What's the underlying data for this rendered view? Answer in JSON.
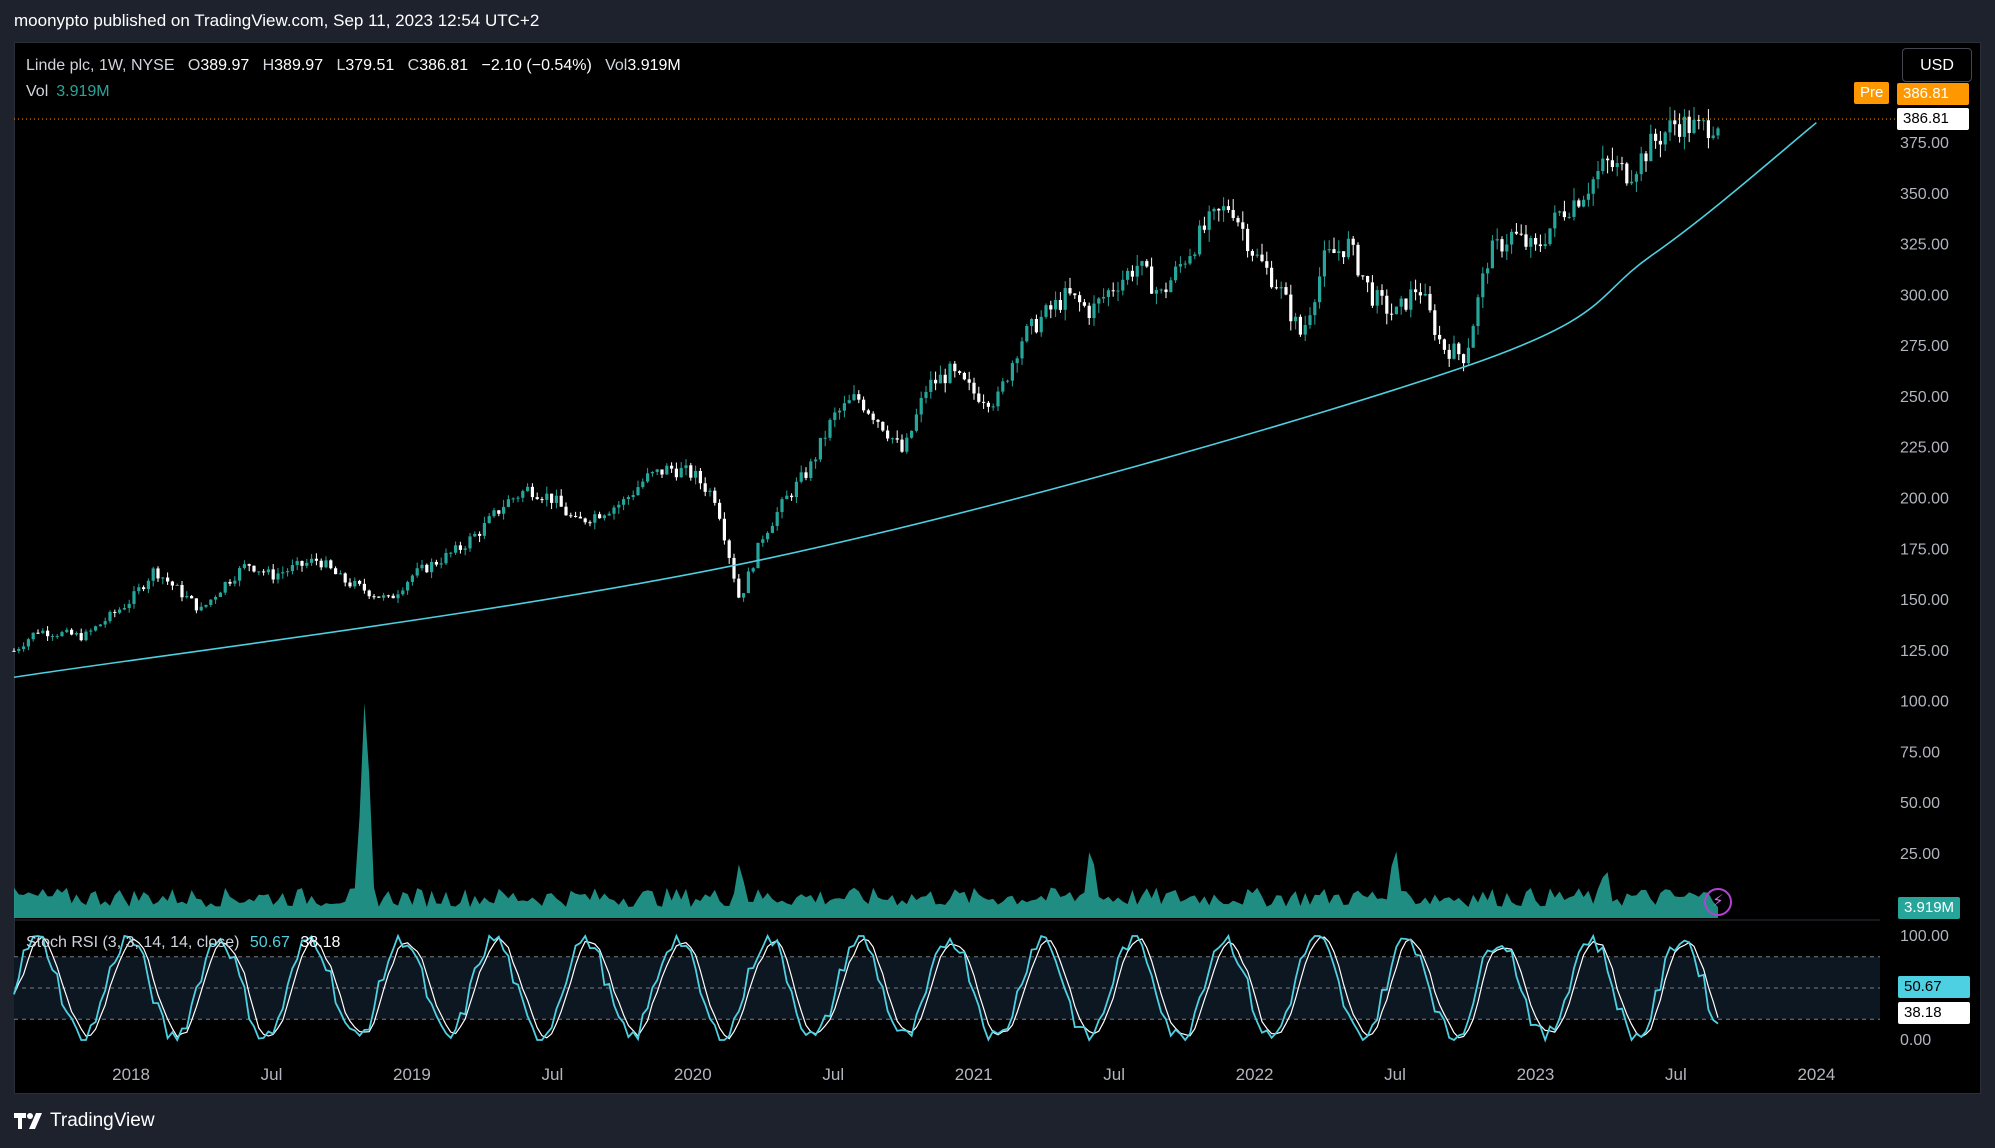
{
  "header": {
    "published": "moonypto published on TradingView.com, Sep 11, 2023 12:54 UTC+2"
  },
  "legend": {
    "symbol": "Linde plc, 1W, NYSE",
    "o_label": "O",
    "o": "389.97",
    "h_label": "H",
    "h": "389.97",
    "l_label": "L",
    "l": "379.51",
    "c_label": "C",
    "c": "386.81",
    "change": "−2.10 (−0.54%)",
    "vol_label": "Vol",
    "vol": "3.919M",
    "vol_row_label": "Vol",
    "vol_row_value": "3.919M"
  },
  "currency_button": "USD",
  "price_tags": {
    "pre_label": "Pre",
    "pre_price": "386.81",
    "last_price": "386.81",
    "volume": "3.919M",
    "stoch_k": "50.67",
    "stoch_d": "38.18"
  },
  "stoch_legend": {
    "name": "Stoch RSI (3, 3, 14, 14, close)",
    "k": "50.67",
    "d": "38.18"
  },
  "footer": {
    "brand": "TradingView"
  },
  "colors": {
    "up": "#26a69a",
    "down": "#ffffff",
    "trend": "#4dd0e1",
    "volume": "#26a69a",
    "k_line": "#4dd0e1",
    "d_line": "#ffffff",
    "pre": "#ff9800"
  },
  "chart_data": {
    "type": "candlestick",
    "title": "Linde plc, 1W, NYSE",
    "y_axis": {
      "ticks": [
        "375.00",
        "350.00",
        "325.00",
        "300.00",
        "275.00",
        "250.00",
        "225.00",
        "200.00",
        "175.00",
        "150.00",
        "125.00",
        "100.00",
        "75.00",
        "50.00",
        "25.00"
      ],
      "range": [
        0,
        400
      ]
    },
    "x_axis": {
      "ticks": [
        "2018",
        "Jul",
        "2019",
        "Jul",
        "2020",
        "Jul",
        "2021",
        "Jul",
        "2022",
        "Jul",
        "2023",
        "Jul",
        "2024"
      ],
      "range": [
        "2017-08",
        "2024-05"
      ]
    },
    "price_path": [
      [
        "2017-08",
        125
      ],
      [
        "2017-09",
        135
      ],
      [
        "2017-11",
        132
      ],
      [
        "2018-01",
        150
      ],
      [
        "2018-02",
        165
      ],
      [
        "2018-03",
        155
      ],
      [
        "2018-04",
        145
      ],
      [
        "2018-05",
        158
      ],
      [
        "2018-06",
        168
      ],
      [
        "2018-07",
        162
      ],
      [
        "2018-09",
        170
      ],
      [
        "2018-10",
        160
      ],
      [
        "2018-11",
        155
      ],
      [
        "2018-12",
        150
      ],
      [
        "2019-01",
        162
      ],
      [
        "2019-03",
        175
      ],
      [
        "2019-04",
        185
      ],
      [
        "2019-05",
        198
      ],
      [
        "2019-06",
        205
      ],
      [
        "2019-07",
        200
      ],
      [
        "2019-08",
        188
      ],
      [
        "2019-10",
        198
      ],
      [
        "2019-11",
        210
      ],
      [
        "2019-12",
        215
      ],
      [
        "2020-01",
        212
      ],
      [
        "2020-02",
        200
      ],
      [
        "2020-03",
        150
      ],
      [
        "2020-04",
        182
      ],
      [
        "2020-05",
        200
      ],
      [
        "2020-06",
        215
      ],
      [
        "2020-07",
        240
      ],
      [
        "2020-08",
        250
      ],
      [
        "2020-09",
        238
      ],
      [
        "2020-10",
        222
      ],
      [
        "2020-11",
        255
      ],
      [
        "2020-12",
        262
      ],
      [
        "2021-01",
        252
      ],
      [
        "2021-02",
        248
      ],
      [
        "2021-03",
        278
      ],
      [
        "2021-04",
        290
      ],
      [
        "2021-05",
        300
      ],
      [
        "2021-06",
        292
      ],
      [
        "2021-07",
        305
      ],
      [
        "2021-08",
        315
      ],
      [
        "2021-09",
        300
      ],
      [
        "2021-10",
        318
      ],
      [
        "2021-11",
        335
      ],
      [
        "2021-12",
        345
      ],
      [
        "2022-01",
        320
      ],
      [
        "2022-02",
        305
      ],
      [
        "2022-03",
        280
      ],
      [
        "2022-04",
        318
      ],
      [
        "2022-05",
        325
      ],
      [
        "2022-06",
        300
      ],
      [
        "2022-07",
        290
      ],
      [
        "2022-08",
        305
      ],
      [
        "2022-09",
        275
      ],
      [
        "2022-10",
        270
      ],
      [
        "2022-11",
        320
      ],
      [
        "2022-12",
        330
      ],
      [
        "2023-01",
        322
      ],
      [
        "2023-02",
        340
      ],
      [
        "2023-03",
        350
      ],
      [
        "2023-04",
        365
      ],
      [
        "2023-05",
        360
      ],
      [
        "2023-06",
        375
      ],
      [
        "2023-07",
        385
      ],
      [
        "2023-08",
        382
      ],
      [
        "2023-09",
        387
      ]
    ],
    "trend_curve": [
      [
        "2017-08",
        112
      ],
      [
        "2020-04",
        170
      ],
      [
        "2022-10",
        265
      ],
      [
        "2023-06",
        320
      ],
      [
        "2024-01",
        385
      ]
    ],
    "last_price": 386.81,
    "volume_peaks": [
      [
        "2018-11",
        100
      ],
      [
        "2020-03",
        25
      ],
      [
        "2021-06",
        32
      ],
      [
        "2022-07",
        32
      ],
      [
        "2023-04",
        23
      ]
    ],
    "volume_last": "3.919M",
    "stoch_rsi": {
      "k": 50.67,
      "d": 38.18,
      "ticks": [
        "100.00",
        "0.00"
      ],
      "bands": [
        80,
        50,
        20
      ]
    }
  }
}
